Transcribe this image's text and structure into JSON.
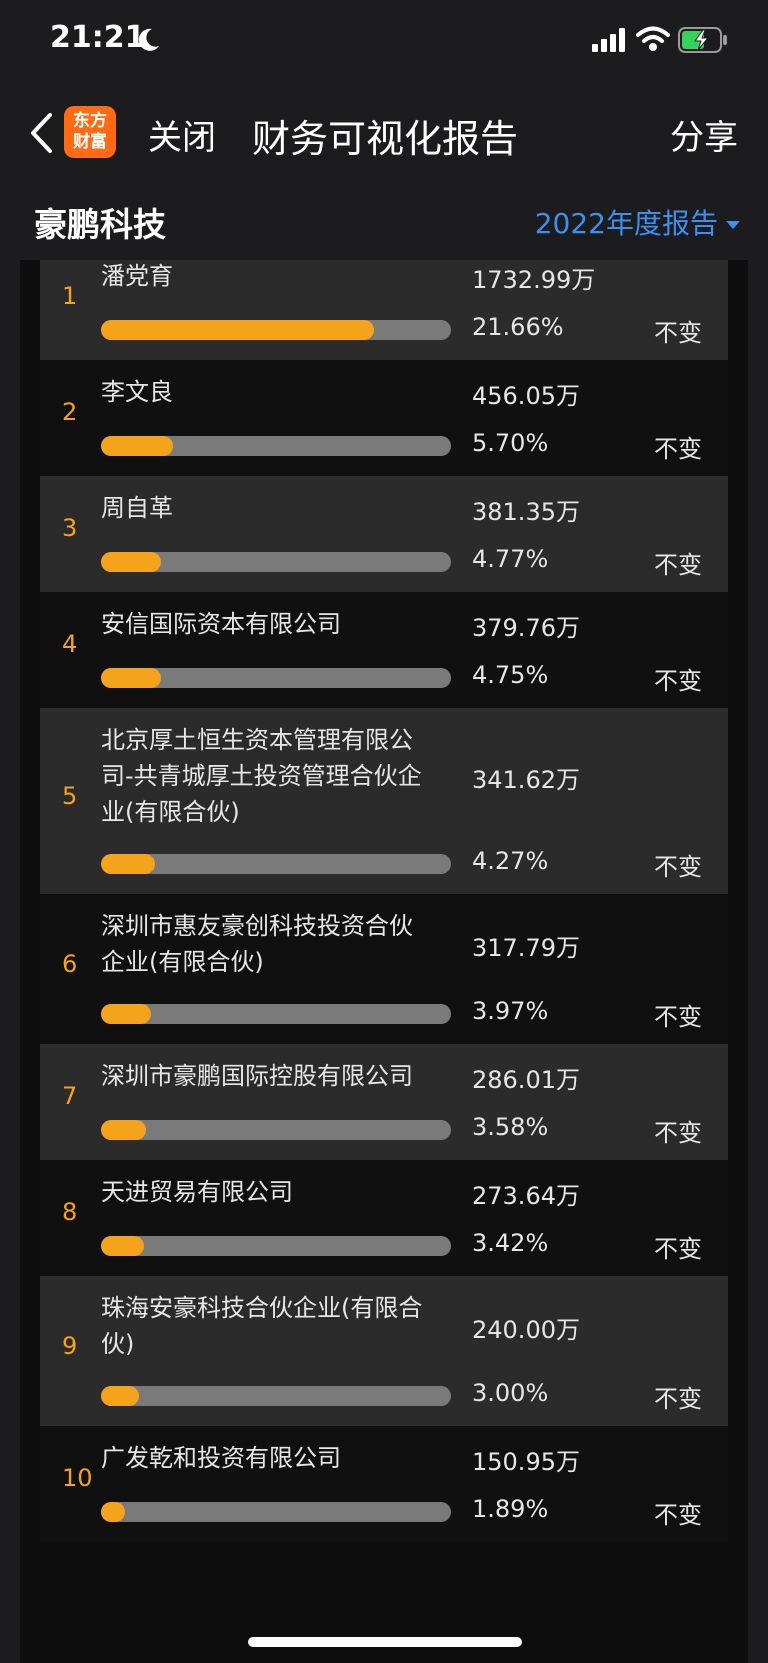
{
  "status_bar": {
    "time": "21:21"
  },
  "nav": {
    "logo_line1": "东方",
    "logo_line2": "财富",
    "close_label": "关闭",
    "title": "财务可视化报告",
    "share_label": "分享"
  },
  "header": {
    "company": "豪鹏科技",
    "report_label": "2022年度报告"
  },
  "colors": {
    "accent": "#f5a31a",
    "link": "#3d8ff0",
    "track": "#7a7a7a"
  },
  "holders": [
    {
      "rank": "1",
      "name": "潘党育",
      "amount": "1732.99万",
      "ratio": "21.66%",
      "change": "不变",
      "pct": 21.66
    },
    {
      "rank": "2",
      "name": "李文良",
      "amount": "456.05万",
      "ratio": "5.70%",
      "change": "不变",
      "pct": 5.7
    },
    {
      "rank": "3",
      "name": "周自革",
      "amount": "381.35万",
      "ratio": "4.77%",
      "change": "不变",
      "pct": 4.77
    },
    {
      "rank": "4",
      "name": "安信国际资本有限公司",
      "amount": "379.76万",
      "ratio": "4.75%",
      "change": "不变",
      "pct": 4.75
    },
    {
      "rank": "5",
      "name": "北京厚土恒生资本管理有限公司-共青城厚土投资管理合伙企业(有限合伙)",
      "amount": "341.62万",
      "ratio": "4.27%",
      "change": "不变",
      "pct": 4.27
    },
    {
      "rank": "6",
      "name": "深圳市惠友豪创科技投资合伙企业(有限合伙)",
      "amount": "317.79万",
      "ratio": "3.97%",
      "change": "不变",
      "pct": 3.97
    },
    {
      "rank": "7",
      "name": "深圳市豪鹏国际控股有限公司",
      "amount": "286.01万",
      "ratio": "3.58%",
      "change": "不变",
      "pct": 3.58
    },
    {
      "rank": "8",
      "name": "天进贸易有限公司",
      "amount": "273.64万",
      "ratio": "3.42%",
      "change": "不变",
      "pct": 3.42
    },
    {
      "rank": "9",
      "name": "珠海安豪科技合伙企业(有限合伙)",
      "amount": "240.00万",
      "ratio": "3.00%",
      "change": "不变",
      "pct": 3.0
    },
    {
      "rank": "10",
      "name": "广发乾和投资有限公司",
      "amount": "150.95万",
      "ratio": "1.89%",
      "change": "不变",
      "pct": 1.89
    }
  ]
}
